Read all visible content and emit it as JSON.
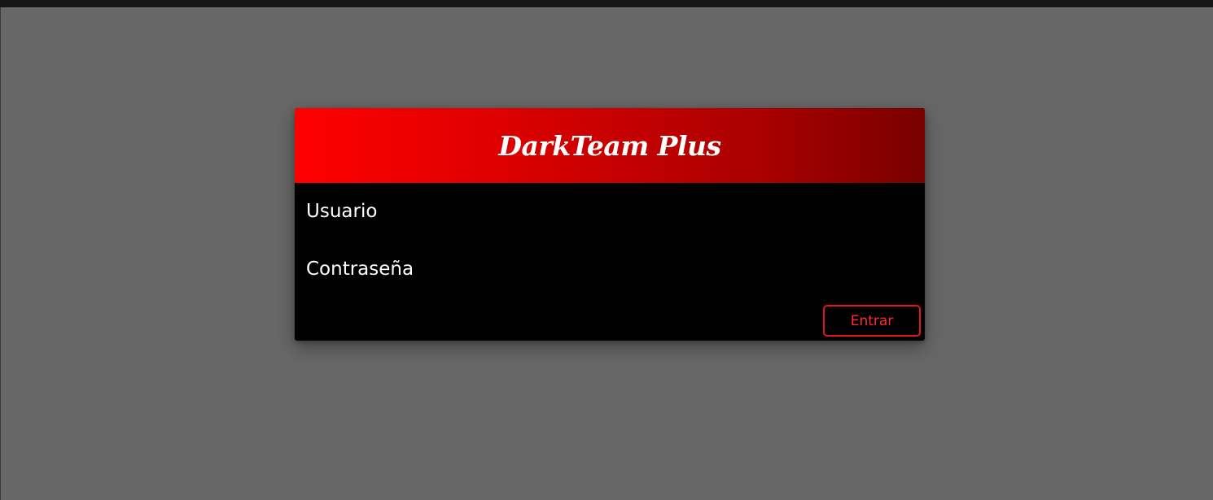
{
  "login": {
    "title": "DarkTeam Plus",
    "username_placeholder": "Usuario",
    "username_value": "",
    "password_placeholder": "Contraseña",
    "password_value": "",
    "submit_label": "Entrar"
  },
  "colors": {
    "page_background": "#676767",
    "top_bar": "#161616",
    "card_background": "#000000",
    "header_gradient_start": "#ff0000",
    "header_gradient_end": "#780000",
    "button_accent": "#e0191b",
    "text": "#ffffff"
  }
}
